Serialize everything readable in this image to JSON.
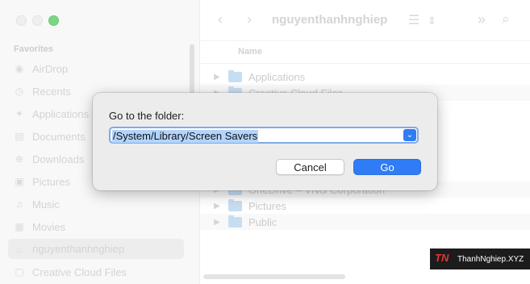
{
  "window": {
    "title": "nguyenthanhnghiep"
  },
  "sidebar": {
    "section": "Favorites",
    "items": [
      {
        "label": "AirDrop",
        "icon": "airdrop-icon",
        "glyph": "◉"
      },
      {
        "label": "Recents",
        "icon": "clock-icon",
        "glyph": "◷"
      },
      {
        "label": "Applications",
        "icon": "applications-icon",
        "glyph": "✦"
      },
      {
        "label": "Documents",
        "icon": "document-icon",
        "glyph": "▤"
      },
      {
        "label": "Downloads",
        "icon": "download-icon",
        "glyph": "⊕"
      },
      {
        "label": "Pictures",
        "icon": "pictures-icon",
        "glyph": "▣"
      },
      {
        "label": "Music",
        "icon": "music-icon",
        "glyph": "♫"
      },
      {
        "label": "Movies",
        "icon": "movies-icon",
        "glyph": "▦"
      },
      {
        "label": "nguyenthanhnghiep",
        "icon": "home-icon",
        "glyph": "⌂"
      },
      {
        "label": "Creative Cloud Files",
        "icon": "folder-icon",
        "glyph": "▢"
      }
    ]
  },
  "toolbar": {
    "back_glyph": "‹",
    "forward_glyph": "›",
    "view_glyph": "☰",
    "sort_glyph": "⇕",
    "more_glyph": "»",
    "search_glyph": "⌕"
  },
  "file_list": {
    "column_name": "Name",
    "rows": [
      {
        "label": "Applications"
      },
      {
        "label": "Creative Cloud Files"
      },
      {
        "label": "OneDrive – VNG Corporation"
      },
      {
        "label": "Pictures"
      },
      {
        "label": "Public"
      }
    ]
  },
  "dialog": {
    "title": "Go to the folder:",
    "path_value": "/System/Library/Screen Savers",
    "dropdown_glyph": "⌄",
    "cancel_label": "Cancel",
    "go_label": "Go"
  },
  "watermark": {
    "logo": "TN",
    "text": "ThanhNghiep.XYZ"
  },
  "colors": {
    "accent": "#2f7cf6",
    "selection": "#b3d4fc",
    "folder": "#a9cdec"
  }
}
